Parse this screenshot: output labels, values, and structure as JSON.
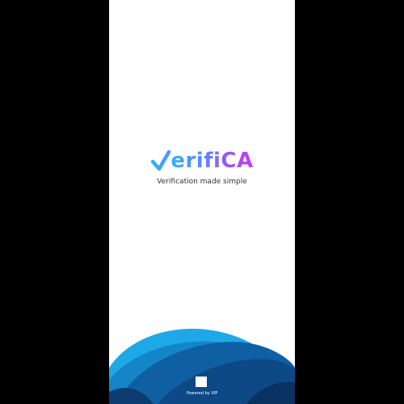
{
  "app": {
    "logo_text": "erifiCA",
    "logo_mark_icon": "checkmark-v-icon",
    "tagline": "Verification made simple",
    "footer_text": "Powered by VIP",
    "footer_icon": "square-logo-icon"
  },
  "colors": {
    "background": "#ffffff",
    "frame": "#000000",
    "logo_gradient_start": "#2fb2ff",
    "logo_gradient_end": "#c43cf2",
    "wave_light": "#1fa8e8",
    "wave_dark": "#0d3f78"
  }
}
